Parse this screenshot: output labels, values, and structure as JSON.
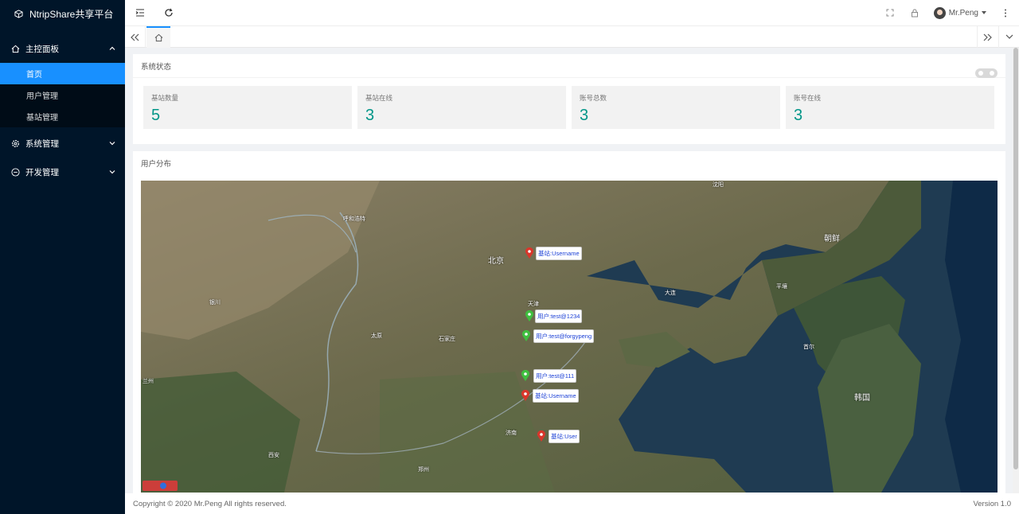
{
  "app": {
    "title": "NtripShare共享平台"
  },
  "sidebar": {
    "groups": [
      {
        "label": "主控面板",
        "expanded": true,
        "items": [
          {
            "label": "首页",
            "active": true
          },
          {
            "label": "用户管理"
          },
          {
            "label": "基站管理"
          }
        ]
      },
      {
        "label": "系统管理",
        "expanded": false
      },
      {
        "label": "开发管理",
        "expanded": false
      }
    ]
  },
  "topbar": {
    "user_name": "Mr.Peng"
  },
  "system_status": {
    "title": "系统状态",
    "stats": [
      {
        "label": "基站数量",
        "value": "5"
      },
      {
        "label": "基站在线",
        "value": "3"
      },
      {
        "label": "账号总数",
        "value": "3"
      },
      {
        "label": "账号在线",
        "value": "3"
      }
    ]
  },
  "user_distribution": {
    "title": "用户分布",
    "map_labels": [
      "北京",
      "天津",
      "朝鲜",
      "韩国",
      "呼和浩特",
      "太原",
      "石家庄",
      "济南",
      "大连",
      "平壤",
      "首尔",
      "沈阳",
      "郑州",
      "西安",
      "银川",
      "兰州"
    ],
    "markers": [
      {
        "label": "基站:Username",
        "type": "station"
      },
      {
        "label": "用户:test@1234",
        "type": "user"
      },
      {
        "label": "用户:test@forgypeng",
        "type": "user"
      },
      {
        "label": "用户:test@111",
        "type": "user"
      },
      {
        "label": "基站:Username",
        "type": "station"
      },
      {
        "label": "基站:User",
        "type": "station"
      }
    ]
  },
  "footer": {
    "copyright": "Copyright © 2020 Mr.Peng All rights reserved.",
    "version": "Version 1.0"
  },
  "colors": {
    "sidebar_bg": "#001529",
    "active": "#1890ff",
    "stat_value": "#009688"
  }
}
